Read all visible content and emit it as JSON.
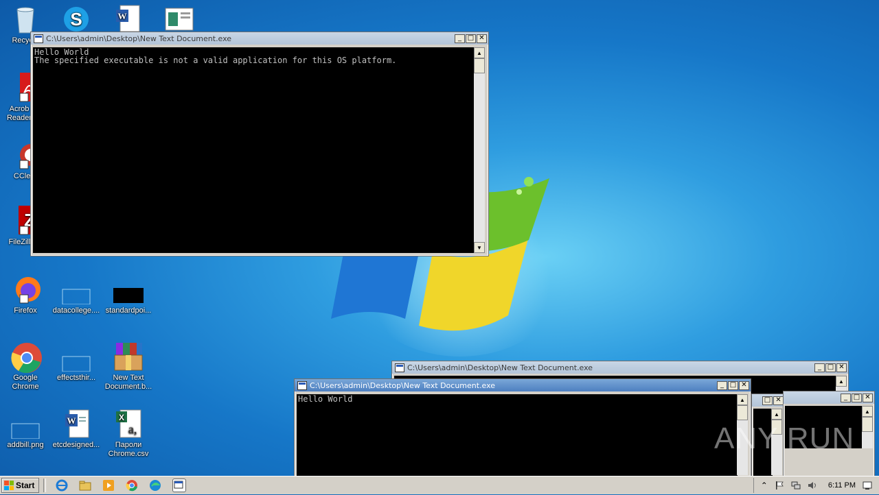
{
  "desktop": {
    "icons": [
      {
        "label": "Recycle",
        "icon": "recycle-bin-icon"
      },
      {
        "label": "",
        "icon": "skype-icon"
      },
      {
        "label": "",
        "icon": "word-doc-icon"
      },
      {
        "label": "",
        "icon": "document-preview-icon"
      },
      {
        "label": "Acrob Reader",
        "icon": "acrobat-reader-icon"
      },
      {
        "label": "CClear",
        "icon": "ccleaner-icon"
      },
      {
        "label": "FileZilla C",
        "icon": "filezilla-icon"
      },
      {
        "label": "Firefox",
        "icon": "firefox-icon"
      },
      {
        "label": "datacollege....",
        "icon": "blank-file-icon"
      },
      {
        "label": "standardpoi...",
        "icon": "black-image-icon"
      },
      {
        "label": "Google Chrome",
        "icon": "chrome-icon"
      },
      {
        "label": "effectsthir...",
        "icon": "blank-file-icon"
      },
      {
        "label": "New Text Document.b...",
        "icon": "winrar-archive-icon"
      },
      {
        "label": "addbill.png",
        "icon": "blank-file-icon"
      },
      {
        "label": "etcdesigned...",
        "icon": "word-doc-icon"
      },
      {
        "label": "Пароли Chrome.csv",
        "icon": "excel-csv-icon"
      }
    ]
  },
  "windows": {
    "main": {
      "title": "C:\\Users\\admin\\Desktop\\New Text Document.exe",
      "lines": [
        "Hello World",
        "The specified executable is not a valid application for this OS platform."
      ]
    },
    "front": {
      "title": "C:\\Users\\admin\\Desktop\\New Text Document.exe",
      "lines": [
        "Hello World"
      ]
    },
    "back": {
      "title": "C:\\Users\\admin\\Desktop\\New Text Document.exe"
    },
    "buttons": {
      "minimize": "_",
      "maximize": "□",
      "close": "✕"
    }
  },
  "taskbar": {
    "start_label": "Start",
    "clock": "6:11 PM",
    "tray_chevron": "⌃"
  },
  "watermark": "ANY RUN"
}
